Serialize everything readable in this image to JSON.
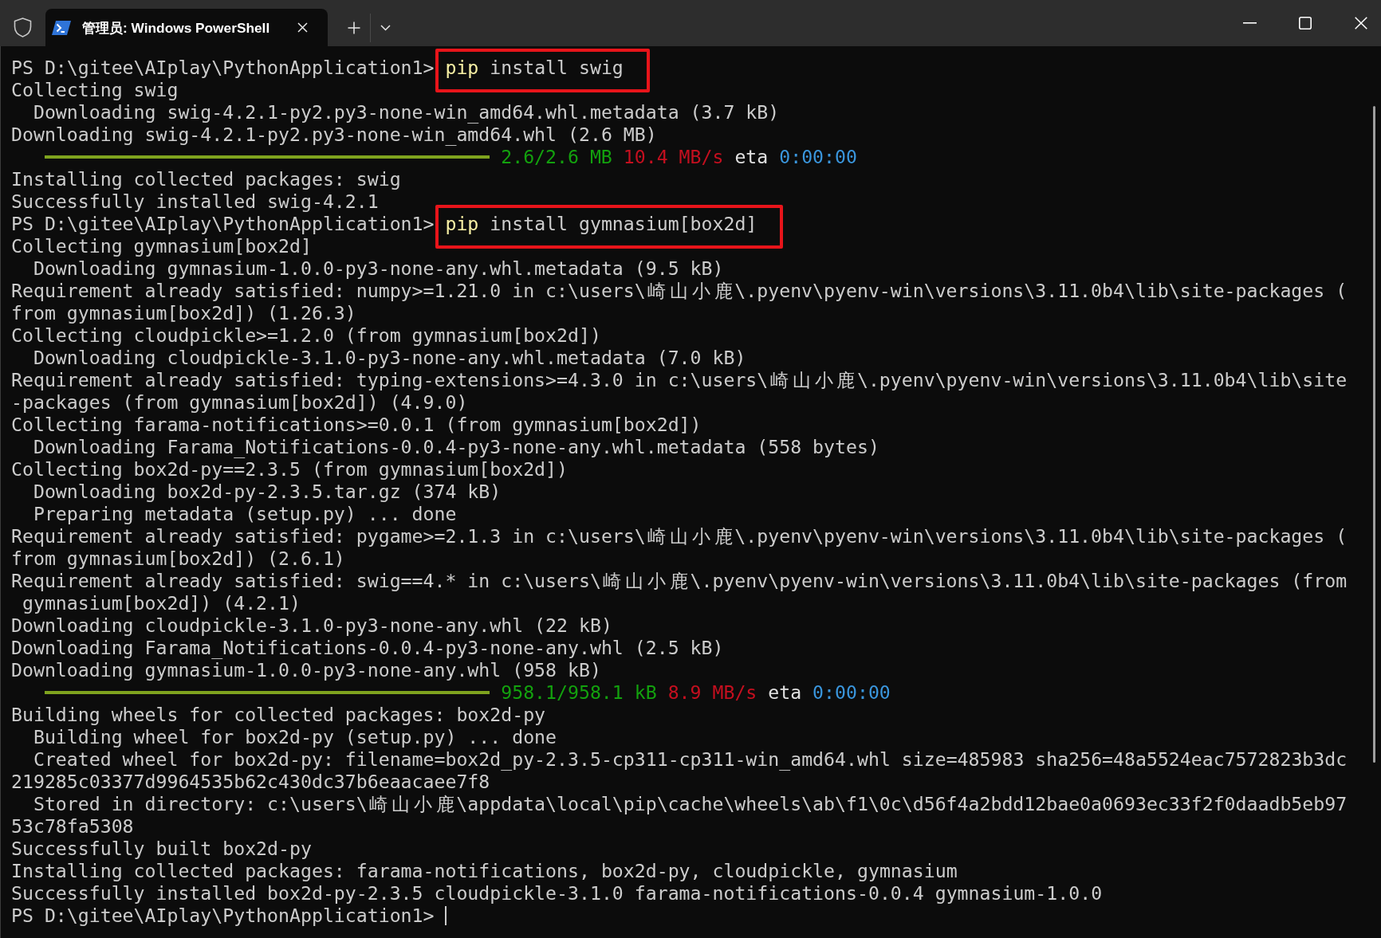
{
  "tabs": [
    {
      "title": "管理员: Windows PowerShell",
      "selected": true
    }
  ],
  "terminal": {
    "lines": [
      {
        "kind": "prompt",
        "prompt": "PS D:\\gitee\\AIplay\\PythonApplication1>",
        "program": "pip",
        "args": "install swig",
        "highlighted": true,
        "cursor": false
      },
      {
        "kind": "text",
        "text": "Collecting swig"
      },
      {
        "kind": "text",
        "text": "  Downloading swig-4.2.1-py2.py3-none-win_amd64.whl.metadata (3.7 kB)"
      },
      {
        "kind": "text",
        "text": "Downloading swig-4.2.1-py2.py3-none-win_amd64.whl (2.6 MB)"
      },
      {
        "kind": "progress",
        "level": 1,
        "size": "2.6/2.6 MB",
        "speed": "10.4 MB/s",
        "eta_label": "eta",
        "eta": "0:00:00"
      },
      {
        "kind": "text",
        "text": "Installing collected packages: swig"
      },
      {
        "kind": "text",
        "text": "Successfully installed swig-4.2.1"
      },
      {
        "kind": "prompt",
        "prompt": "PS D:\\gitee\\AIplay\\PythonApplication1>",
        "program": "pip",
        "args": "install gymnasium[box2d]",
        "highlighted": true,
        "cursor": false
      },
      {
        "kind": "text",
        "text": "Collecting gymnasium[box2d]"
      },
      {
        "kind": "text",
        "text": "  Downloading gymnasium-1.0.0-py3-none-any.whl.metadata (9.5 kB)"
      },
      {
        "kind": "text",
        "text": "Requirement already satisfied: numpy>=1.21.0 in c:\\users\\崎山小鹿\\.pyenv\\pyenv-win\\versions\\3.11.0b4\\lib\\site-packages ("
      },
      {
        "kind": "text",
        "text": "from gymnasium[box2d]) (1.26.3)"
      },
      {
        "kind": "text",
        "text": "Collecting cloudpickle>=1.2.0 (from gymnasium[box2d])"
      },
      {
        "kind": "text",
        "text": "  Downloading cloudpickle-3.1.0-py3-none-any.whl.metadata (7.0 kB)"
      },
      {
        "kind": "text",
        "text": "Requirement already satisfied: typing-extensions>=4.3.0 in c:\\users\\崎山小鹿\\.pyenv\\pyenv-win\\versions\\3.11.0b4\\lib\\site"
      },
      {
        "kind": "text",
        "text": "-packages (from gymnasium[box2d]) (4.9.0)"
      },
      {
        "kind": "text",
        "text": "Collecting farama-notifications>=0.0.1 (from gymnasium[box2d])"
      },
      {
        "kind": "text",
        "text": "  Downloading Farama_Notifications-0.0.4-py3-none-any.whl.metadata (558 bytes)"
      },
      {
        "kind": "text",
        "text": "Collecting box2d-py==2.3.5 (from gymnasium[box2d])"
      },
      {
        "kind": "text",
        "text": "  Downloading box2d-py-2.3.5.tar.gz (374 kB)"
      },
      {
        "kind": "text",
        "text": "  Preparing metadata (setup.py) ... done"
      },
      {
        "kind": "text",
        "text": "Requirement already satisfied: pygame>=2.1.3 in c:\\users\\崎山小鹿\\.pyenv\\pyenv-win\\versions\\3.11.0b4\\lib\\site-packages ("
      },
      {
        "kind": "text",
        "text": "from gymnasium[box2d]) (2.6.1)"
      },
      {
        "kind": "text",
        "text": "Requirement already satisfied: swig==4.* in c:\\users\\崎山小鹿\\.pyenv\\pyenv-win\\versions\\3.11.0b4\\lib\\site-packages (from"
      },
      {
        "kind": "text",
        "text": " gymnasium[box2d]) (4.2.1)"
      },
      {
        "kind": "text",
        "text": "Downloading cloudpickle-3.1.0-py3-none-any.whl (22 kB)"
      },
      {
        "kind": "text",
        "text": "Downloading Farama_Notifications-0.0.4-py3-none-any.whl (2.5 kB)"
      },
      {
        "kind": "text",
        "text": "Downloading gymnasium-1.0.0-py3-none-any.whl (958 kB)"
      },
      {
        "kind": "progress",
        "level": 1,
        "size": "958.1/958.1 kB",
        "speed": "8.9 MB/s",
        "eta_label": "eta",
        "eta": "0:00:00"
      },
      {
        "kind": "text",
        "text": "Building wheels for collected packages: box2d-py"
      },
      {
        "kind": "text",
        "text": "  Building wheel for box2d-py (setup.py) ... done"
      },
      {
        "kind": "text",
        "text": "  Created wheel for box2d-py: filename=box2d_py-2.3.5-cp311-cp311-win_amd64.whl size=485983 sha256=48a5524eac7572823b3dc"
      },
      {
        "kind": "text",
        "text": "219285c03377d9964535b62c430dc37b6eaacaee7f8"
      },
      {
        "kind": "text",
        "text": "  Stored in directory: c:\\users\\崎山小鹿\\appdata\\local\\pip\\cache\\wheels\\ab\\f1\\0c\\d56f4a2bdd12bae0a0693ec33f2f0daadb5eb97"
      },
      {
        "kind": "text",
        "text": "53c78fa5308"
      },
      {
        "kind": "text",
        "text": "Successfully built box2d-py"
      },
      {
        "kind": "text",
        "text": "Installing collected packages: farama-notifications, box2d-py, cloudpickle, gymnasium"
      },
      {
        "kind": "text",
        "text": "Successfully installed box2d-py-2.3.5 cloudpickle-3.1.0 farama-notifications-0.0.4 gymnasium-1.0.0"
      },
      {
        "kind": "prompt",
        "prompt": "PS D:\\gitee\\AIplay\\PythonApplication1>",
        "highlighted": false,
        "cursor": true
      }
    ]
  }
}
